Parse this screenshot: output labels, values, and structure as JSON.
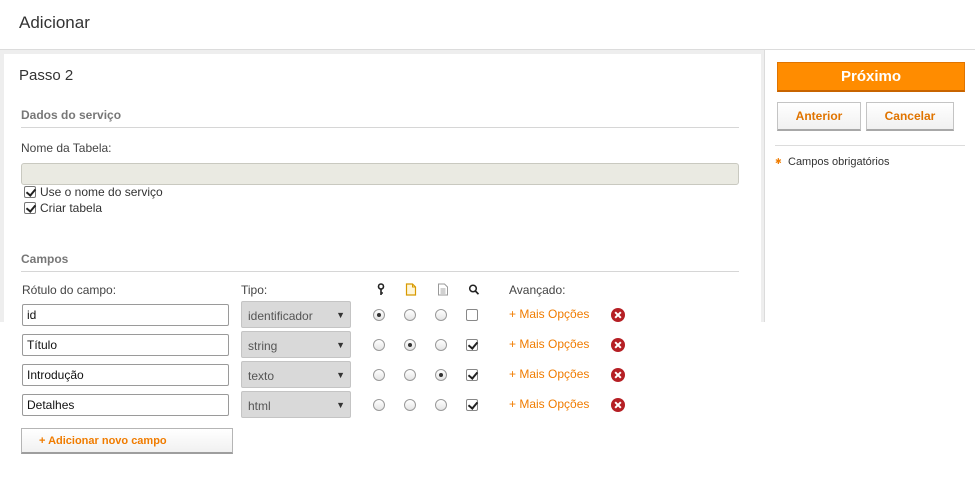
{
  "header": {
    "title": "Adicionar"
  },
  "step": {
    "title": "Passo 2"
  },
  "service_section": {
    "title": "Dados do serviço",
    "table_name_label": "Nome da Tabela:",
    "table_name_value": "",
    "use_service_name_label": "Use o nome do serviço",
    "use_service_name_checked": true,
    "create_table_label": "Criar tabela",
    "create_table_checked": true
  },
  "fields_section": {
    "title": "Campos",
    "columns": {
      "label": "Rótulo do campo:",
      "type": "Tipo:",
      "key_icon": "key-icon",
      "title_icon": "document-icon",
      "content_icon": "text-document-icon",
      "search_icon": "search-icon",
      "advanced": "Avançado:"
    },
    "rows": [
      {
        "label": "id",
        "type": "identificador",
        "radio": 0,
        "searchable": false,
        "more": "+ Mais Opções"
      },
      {
        "label": "Título",
        "type": "string",
        "radio": 1,
        "searchable": true,
        "more": "+ Mais Opções"
      },
      {
        "label": "Introdução",
        "type": "texto",
        "radio": 2,
        "searchable": true,
        "more": "+ Mais Opções"
      },
      {
        "label": "Detalhes",
        "type": "html",
        "radio": -1,
        "searchable": true,
        "more": "+ Mais Opções"
      }
    ],
    "add_button": "+ Adicionar novo campo"
  },
  "sidebar": {
    "next_button": "Próximo",
    "previous_button": "Anterior",
    "cancel_button": "Cancelar",
    "required_note": "Campos obrigatórios"
  },
  "colors": {
    "accent": "#ff8c00",
    "link": "#f07c00",
    "remove": "#b51f24"
  }
}
